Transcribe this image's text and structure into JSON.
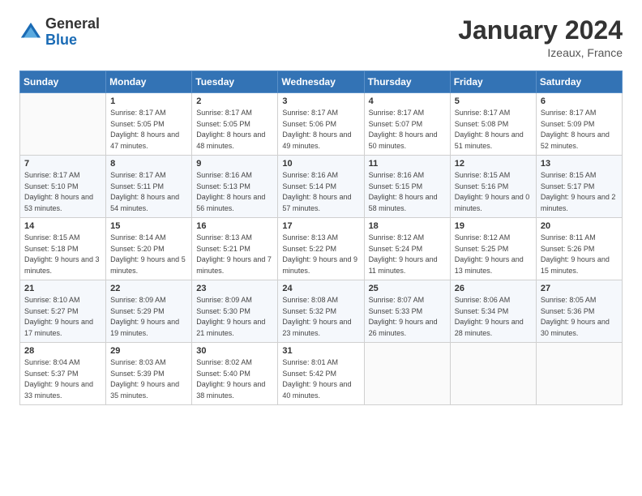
{
  "header": {
    "logo_general": "General",
    "logo_blue": "Blue",
    "month_title": "January 2024",
    "location": "Izeaux, France"
  },
  "columns": [
    "Sunday",
    "Monday",
    "Tuesday",
    "Wednesday",
    "Thursday",
    "Friday",
    "Saturday"
  ],
  "weeks": [
    [
      {
        "day": "",
        "sunrise": "",
        "sunset": "",
        "daylight": ""
      },
      {
        "day": "1",
        "sunrise": "Sunrise: 8:17 AM",
        "sunset": "Sunset: 5:05 PM",
        "daylight": "Daylight: 8 hours and 47 minutes."
      },
      {
        "day": "2",
        "sunrise": "Sunrise: 8:17 AM",
        "sunset": "Sunset: 5:05 PM",
        "daylight": "Daylight: 8 hours and 48 minutes."
      },
      {
        "day": "3",
        "sunrise": "Sunrise: 8:17 AM",
        "sunset": "Sunset: 5:06 PM",
        "daylight": "Daylight: 8 hours and 49 minutes."
      },
      {
        "day": "4",
        "sunrise": "Sunrise: 8:17 AM",
        "sunset": "Sunset: 5:07 PM",
        "daylight": "Daylight: 8 hours and 50 minutes."
      },
      {
        "day": "5",
        "sunrise": "Sunrise: 8:17 AM",
        "sunset": "Sunset: 5:08 PM",
        "daylight": "Daylight: 8 hours and 51 minutes."
      },
      {
        "day": "6",
        "sunrise": "Sunrise: 8:17 AM",
        "sunset": "Sunset: 5:09 PM",
        "daylight": "Daylight: 8 hours and 52 minutes."
      }
    ],
    [
      {
        "day": "7",
        "sunrise": "Sunrise: 8:17 AM",
        "sunset": "Sunset: 5:10 PM",
        "daylight": "Daylight: 8 hours and 53 minutes."
      },
      {
        "day": "8",
        "sunrise": "Sunrise: 8:17 AM",
        "sunset": "Sunset: 5:11 PM",
        "daylight": "Daylight: 8 hours and 54 minutes."
      },
      {
        "day": "9",
        "sunrise": "Sunrise: 8:16 AM",
        "sunset": "Sunset: 5:13 PM",
        "daylight": "Daylight: 8 hours and 56 minutes."
      },
      {
        "day": "10",
        "sunrise": "Sunrise: 8:16 AM",
        "sunset": "Sunset: 5:14 PM",
        "daylight": "Daylight: 8 hours and 57 minutes."
      },
      {
        "day": "11",
        "sunrise": "Sunrise: 8:16 AM",
        "sunset": "Sunset: 5:15 PM",
        "daylight": "Daylight: 8 hours and 58 minutes."
      },
      {
        "day": "12",
        "sunrise": "Sunrise: 8:15 AM",
        "sunset": "Sunset: 5:16 PM",
        "daylight": "Daylight: 9 hours and 0 minutes."
      },
      {
        "day": "13",
        "sunrise": "Sunrise: 8:15 AM",
        "sunset": "Sunset: 5:17 PM",
        "daylight": "Daylight: 9 hours and 2 minutes."
      }
    ],
    [
      {
        "day": "14",
        "sunrise": "Sunrise: 8:15 AM",
        "sunset": "Sunset: 5:18 PM",
        "daylight": "Daylight: 9 hours and 3 minutes."
      },
      {
        "day": "15",
        "sunrise": "Sunrise: 8:14 AM",
        "sunset": "Sunset: 5:20 PM",
        "daylight": "Daylight: 9 hours and 5 minutes."
      },
      {
        "day": "16",
        "sunrise": "Sunrise: 8:13 AM",
        "sunset": "Sunset: 5:21 PM",
        "daylight": "Daylight: 9 hours and 7 minutes."
      },
      {
        "day": "17",
        "sunrise": "Sunrise: 8:13 AM",
        "sunset": "Sunset: 5:22 PM",
        "daylight": "Daylight: 9 hours and 9 minutes."
      },
      {
        "day": "18",
        "sunrise": "Sunrise: 8:12 AM",
        "sunset": "Sunset: 5:24 PM",
        "daylight": "Daylight: 9 hours and 11 minutes."
      },
      {
        "day": "19",
        "sunrise": "Sunrise: 8:12 AM",
        "sunset": "Sunset: 5:25 PM",
        "daylight": "Daylight: 9 hours and 13 minutes."
      },
      {
        "day": "20",
        "sunrise": "Sunrise: 8:11 AM",
        "sunset": "Sunset: 5:26 PM",
        "daylight": "Daylight: 9 hours and 15 minutes."
      }
    ],
    [
      {
        "day": "21",
        "sunrise": "Sunrise: 8:10 AM",
        "sunset": "Sunset: 5:27 PM",
        "daylight": "Daylight: 9 hours and 17 minutes."
      },
      {
        "day": "22",
        "sunrise": "Sunrise: 8:09 AM",
        "sunset": "Sunset: 5:29 PM",
        "daylight": "Daylight: 9 hours and 19 minutes."
      },
      {
        "day": "23",
        "sunrise": "Sunrise: 8:09 AM",
        "sunset": "Sunset: 5:30 PM",
        "daylight": "Daylight: 9 hours and 21 minutes."
      },
      {
        "day": "24",
        "sunrise": "Sunrise: 8:08 AM",
        "sunset": "Sunset: 5:32 PM",
        "daylight": "Daylight: 9 hours and 23 minutes."
      },
      {
        "day": "25",
        "sunrise": "Sunrise: 8:07 AM",
        "sunset": "Sunset: 5:33 PM",
        "daylight": "Daylight: 9 hours and 26 minutes."
      },
      {
        "day": "26",
        "sunrise": "Sunrise: 8:06 AM",
        "sunset": "Sunset: 5:34 PM",
        "daylight": "Daylight: 9 hours and 28 minutes."
      },
      {
        "day": "27",
        "sunrise": "Sunrise: 8:05 AM",
        "sunset": "Sunset: 5:36 PM",
        "daylight": "Daylight: 9 hours and 30 minutes."
      }
    ],
    [
      {
        "day": "28",
        "sunrise": "Sunrise: 8:04 AM",
        "sunset": "Sunset: 5:37 PM",
        "daylight": "Daylight: 9 hours and 33 minutes."
      },
      {
        "day": "29",
        "sunrise": "Sunrise: 8:03 AM",
        "sunset": "Sunset: 5:39 PM",
        "daylight": "Daylight: 9 hours and 35 minutes."
      },
      {
        "day": "30",
        "sunrise": "Sunrise: 8:02 AM",
        "sunset": "Sunset: 5:40 PM",
        "daylight": "Daylight: 9 hours and 38 minutes."
      },
      {
        "day": "31",
        "sunrise": "Sunrise: 8:01 AM",
        "sunset": "Sunset: 5:42 PM",
        "daylight": "Daylight: 9 hours and 40 minutes."
      },
      {
        "day": "",
        "sunrise": "",
        "sunset": "",
        "daylight": ""
      },
      {
        "day": "",
        "sunrise": "",
        "sunset": "",
        "daylight": ""
      },
      {
        "day": "",
        "sunrise": "",
        "sunset": "",
        "daylight": ""
      }
    ]
  ]
}
